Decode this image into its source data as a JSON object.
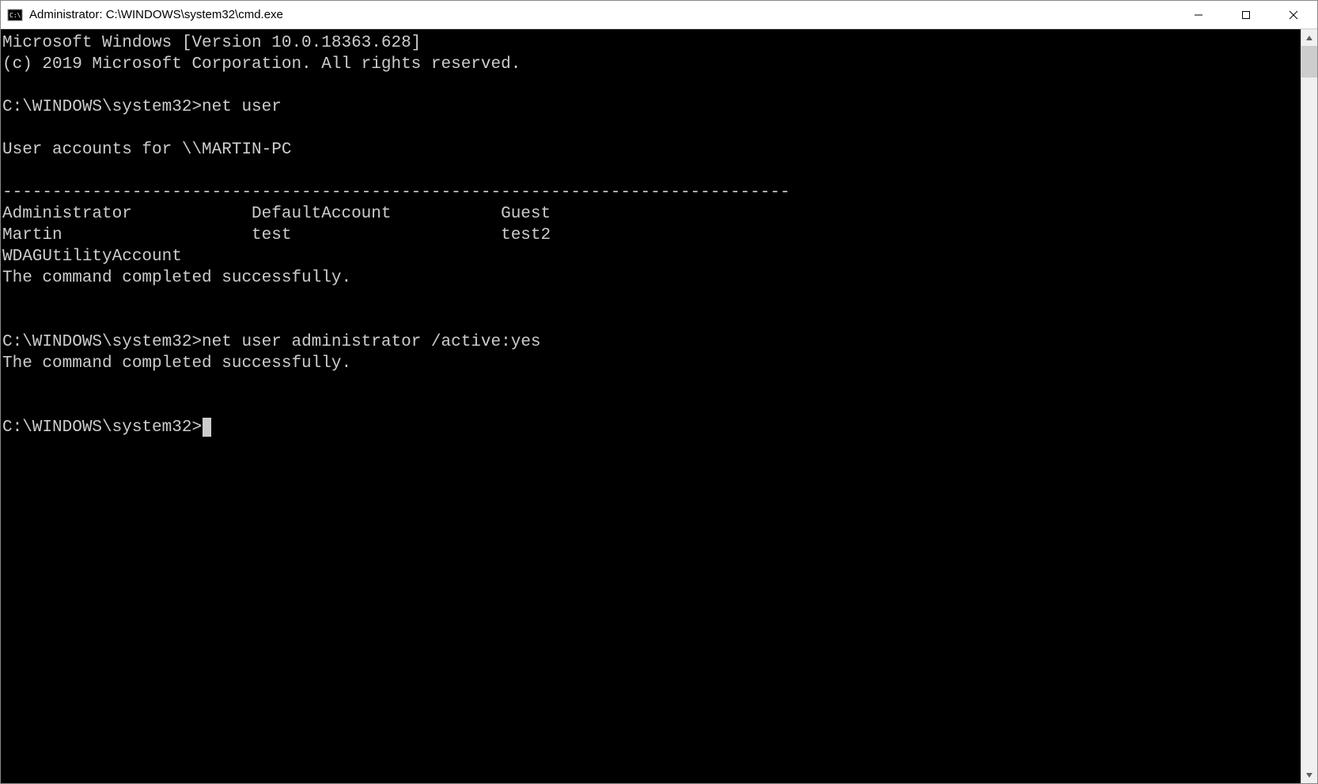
{
  "window": {
    "title": "Administrator: C:\\WINDOWS\\system32\\cmd.exe"
  },
  "terminal": {
    "banner_line1": "Microsoft Windows [Version 10.0.18363.628]",
    "banner_line2": "(c) 2019 Microsoft Corporation. All rights reserved.",
    "prompt1": "C:\\WINDOWS\\system32>",
    "cmd1": "net user",
    "accounts_header": "User accounts for \\\\MARTIN-PC",
    "separator": "-------------------------------------------------------------------------------",
    "row1": {
      "c1": "Administrator",
      "c2": "DefaultAccount",
      "c3": "Guest"
    },
    "row2": {
      "c1": "Martin",
      "c2": "test",
      "c3": "test2"
    },
    "row3": {
      "c1": "WDAGUtilityAccount",
      "c2": "",
      "c3": ""
    },
    "success1": "The command completed successfully.",
    "prompt2": "C:\\WINDOWS\\system32>",
    "cmd2": "net user administrator /active:yes",
    "success2": "The command completed successfully.",
    "prompt3": "C:\\WINDOWS\\system32>"
  }
}
